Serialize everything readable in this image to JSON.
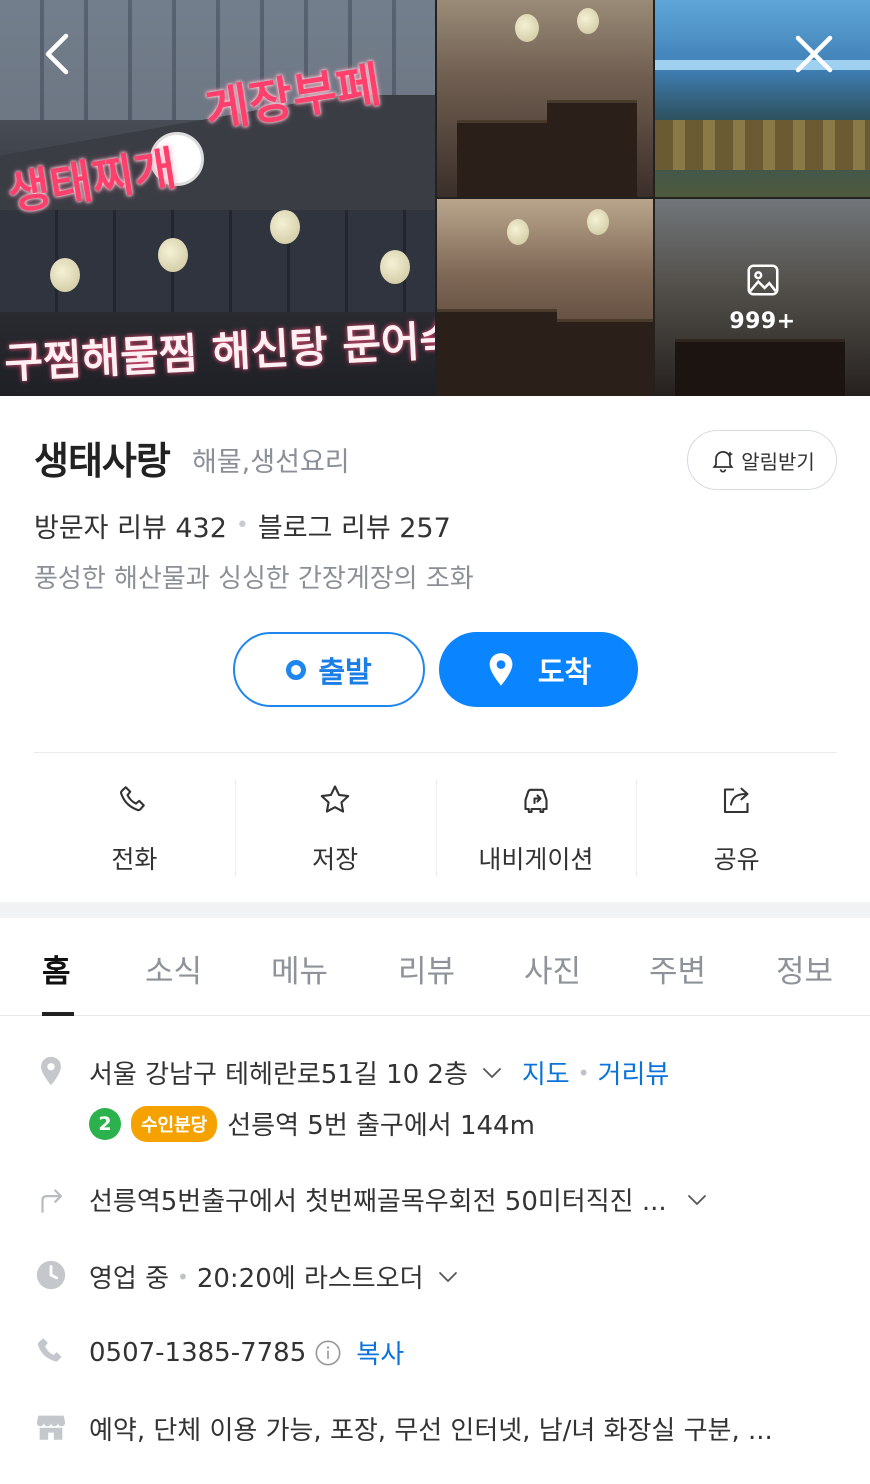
{
  "gallery": {
    "main_sign_top_right": "게장부페",
    "main_sign_top_left": "생태찌개",
    "main_sign_bottom": "구찜해물찜 해신탕 문어숙",
    "photo_count": "999+"
  },
  "place": {
    "name": "생태사랑",
    "category": "해물,생선요리",
    "alarm_label": "알림받기",
    "visitor_review": "방문자 리뷰 432",
    "blog_review": "블로그 리뷰 257",
    "dot": "•",
    "description": "풍성한 해산물과 싱싱한 간장게장의 조화"
  },
  "route": {
    "depart_label": "출발",
    "arrive_label": "도착"
  },
  "actions": [
    {
      "label": "전화",
      "icon": "phone-icon"
    },
    {
      "label": "저장",
      "icon": "star-icon"
    },
    {
      "label": "내비게이션",
      "icon": "navigation-icon"
    },
    {
      "label": "공유",
      "icon": "share-icon"
    }
  ],
  "tabs": [
    {
      "label": "홈",
      "active": true
    },
    {
      "label": "소식"
    },
    {
      "label": "메뉴"
    },
    {
      "label": "리뷰"
    },
    {
      "label": "사진"
    },
    {
      "label": "주변"
    },
    {
      "label": "정보"
    }
  ],
  "info": {
    "address": "서울 강남구 테헤란로51길 10 2층",
    "map_link": "지도",
    "street_view_link": "거리뷰",
    "subway_line_number": "2",
    "subway_line_tag": "수인분당",
    "subway_text": "선릉역 5번 출구에서 144m",
    "directions": "선릉역5번출구에서 첫번째골목우회전 50미터직진 ...",
    "status": "영업 중",
    "last_order": "20:20에 라스트오더",
    "phone": "0507-1385-7785",
    "copy_label": "복사",
    "amenities": "예약, 단체 이용 가능, 포장, 무선 인터넷, 남/녀 화장실 구분, ..."
  },
  "colors": {
    "accent": "#0a84ff",
    "link": "#0b73d9",
    "line2": "#2bb24c",
    "suin_bundang": "#f5a200"
  }
}
